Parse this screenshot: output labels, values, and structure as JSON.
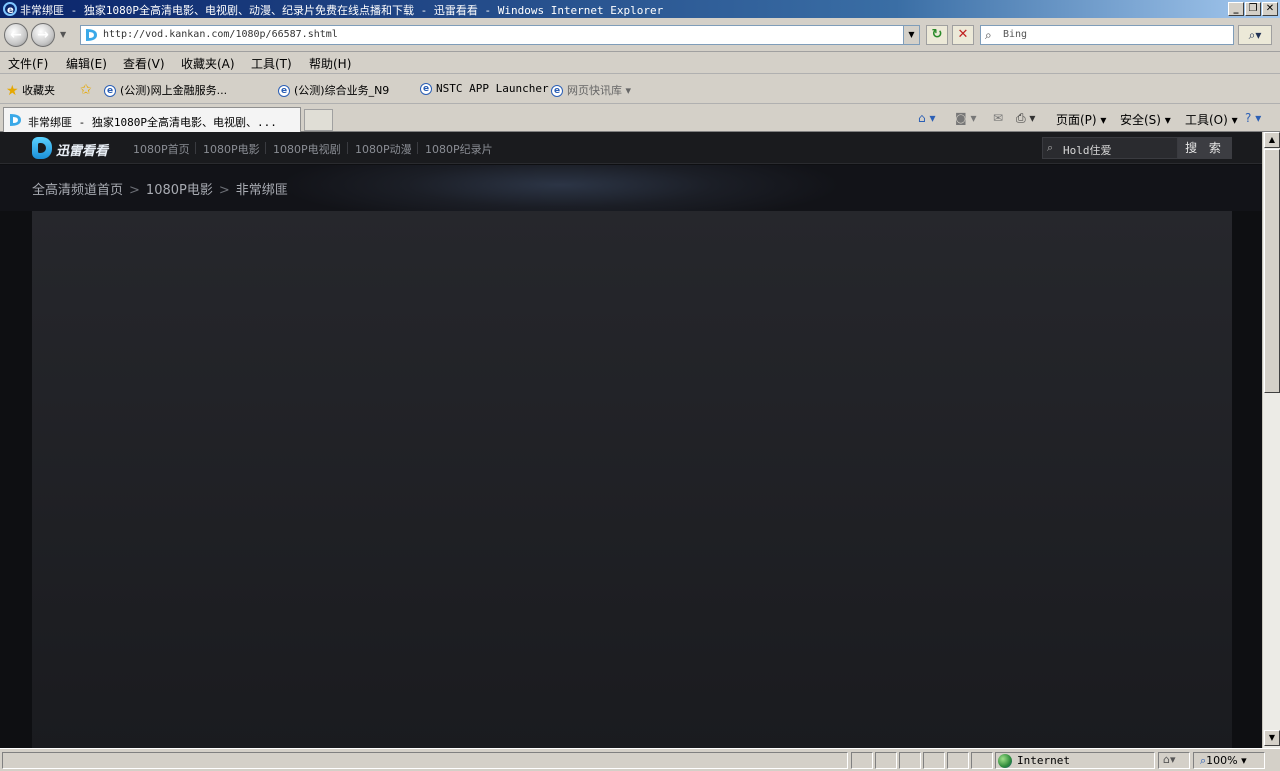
{
  "window": {
    "title": "非常绑匪 - 独家1080P全高清电影、电视剧、动漫、纪录片免费在线点播和下载 - 迅雷看看 - Windows Internet Explorer",
    "min_glyph": "_",
    "max_glyph": "❐",
    "close_glyph": "✕"
  },
  "address_bar": {
    "url": "http://vod.kankan.com/1080p/66587.shtml",
    "search_placeholder": "Bing",
    "refresh_glyph": "↻",
    "stop_glyph": "✕",
    "back_glyph": "←",
    "forward_glyph": "→"
  },
  "menu": {
    "file": "文件(F)",
    "edit": "编辑(E)",
    "view": "查看(V)",
    "favorites": "收藏夹(A)",
    "tools": "工具(T)",
    "help": "帮助(H)"
  },
  "favorites_bar": {
    "label": "收藏夹",
    "items": [
      "(公测)网上金融服务...",
      "(公测)综合业务_N9",
      "NSTC APP Launcher",
      "网页快讯库"
    ]
  },
  "tabs": {
    "active_title": "非常绑匪 - 独家1080P全高清电影、电视剧、..."
  },
  "command_bar": {
    "page": "页面(P)",
    "safety": "安全(S)",
    "tools": "工具(O)"
  },
  "site": {
    "logo_text": "迅雷看看",
    "nav": [
      "1080P首页",
      "1080P电影",
      "1080P电视剧",
      "1080P动漫",
      "1080P纪录片"
    ],
    "search_value": "Hold住爱",
    "search_button": "搜 索",
    "breadcrumb": [
      "全高清频道首页",
      "1080P电影",
      "非常绑匪"
    ],
    "breadcrumb_sep": ">"
  },
  "status_bar": {
    "zone": "Internet",
    "zoom": "100%"
  }
}
